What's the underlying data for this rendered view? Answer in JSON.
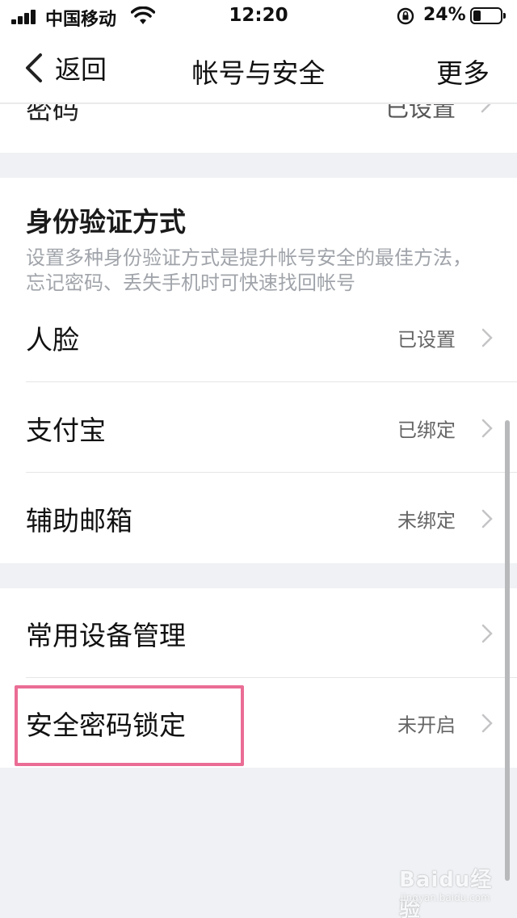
{
  "status_bar": {
    "carrier": "中国移动",
    "time": "12:20",
    "battery_percent": "24%"
  },
  "nav": {
    "back_label": "返回",
    "title": "帐号与安全",
    "more_label": "更多"
  },
  "partial_row": {
    "label": "密码",
    "value": "已设置"
  },
  "auth_section": {
    "title": "身份验证方式",
    "description": "设置多种身份验证方式是提升帐号安全的最佳方法，忘记密码、丢失手机时可快速找回帐号",
    "items": [
      {
        "label": "人脸",
        "value": "已设置"
      },
      {
        "label": "支付宝",
        "value": "已绑定"
      },
      {
        "label": "辅助邮箱",
        "value": "未绑定"
      }
    ]
  },
  "device_section": {
    "items": [
      {
        "label": "常用设备管理",
        "value": ""
      },
      {
        "label": "安全密码锁定",
        "value": "未开启"
      }
    ]
  },
  "watermark": {
    "main": "Baidu经验",
    "sub": "jingyan.baidu.com"
  },
  "colors": {
    "background": "#eff1f4",
    "highlight_border": "#ea6d95",
    "secondary_text": "#a0a4aa"
  }
}
